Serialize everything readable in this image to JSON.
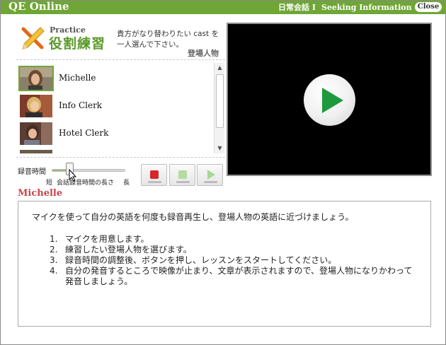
{
  "header": {
    "brand": "QE Online",
    "lesson_ja": "日常会話 I",
    "lesson_en": "Seeking Information",
    "close_label": "Close"
  },
  "practice": {
    "label_en": "Practice",
    "label_ja": "役割練習",
    "instruction": "貴方がなり替わりたい cast を一人選んで下さい。",
    "cast_heading": "登場人物"
  },
  "cast": [
    {
      "name": "Michelle",
      "selected": true
    },
    {
      "name": "Info Clerk",
      "selected": false
    },
    {
      "name": "Hotel Clerk",
      "selected": false
    }
  ],
  "recording": {
    "label": "録音時間",
    "min_label": "短",
    "mid_label": "会話録音時間の長さ",
    "max_label": "長",
    "level": 0.2
  },
  "colors": {
    "brand_green": "#6fa635",
    "selected_name_red": "#c8454a",
    "stop_red": "#d6262a",
    "play_green": "#1d9a3c"
  },
  "selected_name": "Michelle",
  "info": {
    "intro": "マイクを使って自分の英語を何度も録音再生し、登場人物の英語に近づけましょう。",
    "steps": [
      "マイクを用意します。",
      "練習したい登場人物を選びます。",
      "録音時間の調整後、ボタンを押し、レッスンをスタートしてください。",
      "自分の発音するところで映像が止まり、文章が表示されますので、登場人物になりかわって発音しましょう。"
    ]
  }
}
